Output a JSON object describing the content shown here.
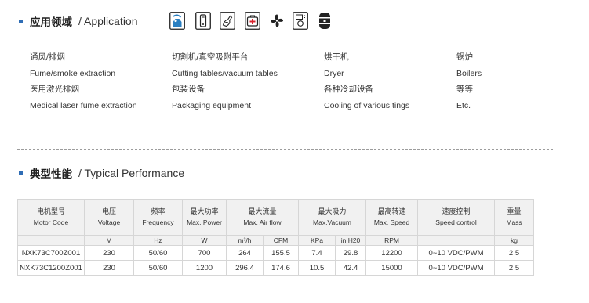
{
  "colors": {
    "accent": "#2f6db5",
    "text": "#333333",
    "table_header_bg": "#f1f1f1",
    "medical_red": "#d9232d",
    "icon_blue": "#2a7fc1"
  },
  "application": {
    "title_cn": "应用领域",
    "title_en": "/ Application",
    "icons": [
      "fume-extraction-icon",
      "handheld-device-icon",
      "hand-tool-icon",
      "medical-kit-icon",
      "fan-icon",
      "dryer-icon",
      "boiler-icon"
    ],
    "columns": [
      {
        "items": [
          "通风/排烟",
          "Fume/smoke extraction",
          "医用激光排烟",
          "Medical laser fume extraction"
        ]
      },
      {
        "items": [
          "切割机/真空吸附平台",
          "Cutting tables/vacuum tables",
          "包装设备",
          "Packaging equipment"
        ]
      },
      {
        "items": [
          "烘干机",
          "Dryer",
          "各种冷却设备",
          "Cooling of various tings"
        ]
      },
      {
        "items": [
          "锅炉",
          "Boilers",
          "等等",
          "Etc."
        ]
      }
    ]
  },
  "performance": {
    "title_cn": "典型性能",
    "title_en": "/ Typical Performance",
    "headers": [
      {
        "cn": "电机型号",
        "en": "Motor Code"
      },
      {
        "cn": "电压",
        "en": "Voltage"
      },
      {
        "cn": "频率",
        "en": "Frequency"
      },
      {
        "cn": "最大功率",
        "en": "Max. Power"
      },
      {
        "cn": "最大流量",
        "en": "Max. Air flow"
      },
      {
        "cn": "最大吸力",
        "en": "Max.Vacuum"
      },
      {
        "cn": "最高转速",
        "en": "Max. Speed"
      },
      {
        "cn": "速度控制",
        "en": "Speed control"
      },
      {
        "cn": "重量",
        "en": "Mass"
      }
    ],
    "units": [
      "",
      "V",
      "Hz",
      "W",
      "m³/h",
      "CFM",
      "KPa",
      "in H20",
      "RPM",
      "",
      "kg"
    ],
    "rows": [
      [
        "NXK73C700Z001",
        "230",
        "50/60",
        "700",
        "264",
        "155.5",
        "7.4",
        "29.8",
        "12200",
        "0~10 VDC/PWM",
        "2.5"
      ],
      [
        "NXK73C1200Z001",
        "230",
        "50/60",
        "1200",
        "296.4",
        "174.6",
        "10.5",
        "42.4",
        "15000",
        "0~10 VDC/PWM",
        "2.5"
      ]
    ]
  }
}
